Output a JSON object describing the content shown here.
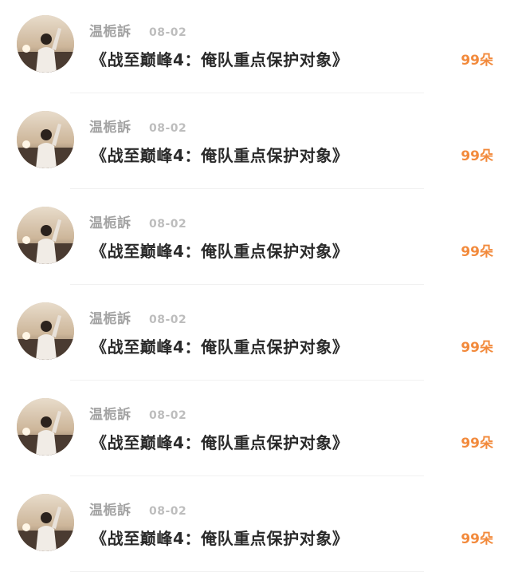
{
  "items": [
    {
      "username": "温栀訴",
      "date": "08-02",
      "title": "《战至巅峰4：俺队重点保护对象》",
      "count": "99朵",
      "avatar_icon": "user-avatar-photo"
    },
    {
      "username": "温栀訴",
      "date": "08-02",
      "title": "《战至巅峰4：俺队重点保护对象》",
      "count": "99朵",
      "avatar_icon": "user-avatar-photo"
    },
    {
      "username": "温栀訴",
      "date": "08-02",
      "title": "《战至巅峰4：俺队重点保护对象》",
      "count": "99朵",
      "avatar_icon": "user-avatar-photo"
    },
    {
      "username": "温栀訴",
      "date": "08-02",
      "title": "《战至巅峰4：俺队重点保护对象》",
      "count": "99朵",
      "avatar_icon": "user-avatar-photo"
    },
    {
      "username": "温栀訴",
      "date": "08-02",
      "title": "《战至巅峰4：俺队重点保护对象》",
      "count": "99朵",
      "avatar_icon": "user-avatar-photo"
    },
    {
      "username": "温栀訴",
      "date": "08-02",
      "title": "《战至巅峰4：俺队重点保护对象》",
      "count": "99朵",
      "avatar_icon": "user-avatar-photo"
    }
  ],
  "colors": {
    "background": "#ffffff",
    "username": "#a3a3a3",
    "date": "#bdbdbd",
    "title": "#2a2a2a",
    "count_accent": "#f28a3c",
    "divider": "#f1f1f1"
  }
}
